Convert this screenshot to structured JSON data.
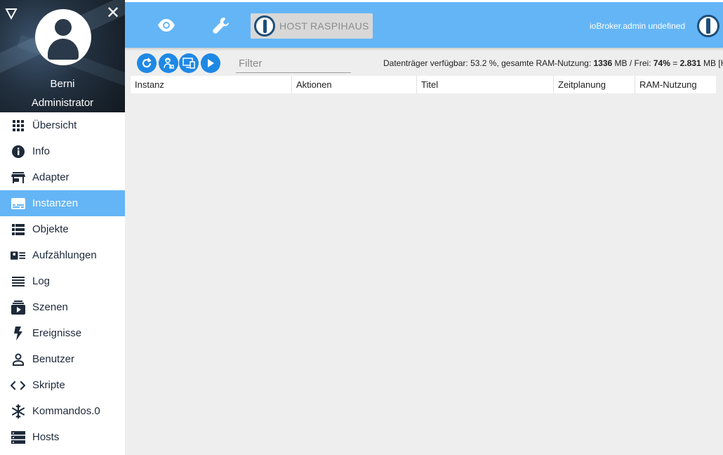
{
  "sidebar": {
    "user": {
      "name": "Berni",
      "role": "Administrator"
    },
    "items": [
      {
        "label": "Übersicht",
        "icon": "grid-icon",
        "active": false
      },
      {
        "label": "Info",
        "icon": "info-icon",
        "active": false
      },
      {
        "label": "Adapter",
        "icon": "store-icon",
        "active": false
      },
      {
        "label": "Instanzen",
        "icon": "instances-icon",
        "active": true
      },
      {
        "label": "Objekte",
        "icon": "list-icon",
        "active": false
      },
      {
        "label": "Aufzählungen",
        "icon": "enum-icon",
        "active": false
      },
      {
        "label": "Log",
        "icon": "log-icon",
        "active": false
      },
      {
        "label": "Szenen",
        "icon": "scenes-icon",
        "active": false
      },
      {
        "label": "Ereignisse",
        "icon": "lightning-icon",
        "active": false
      },
      {
        "label": "Benutzer",
        "icon": "user-icon",
        "active": false
      },
      {
        "label": "Skripte",
        "icon": "code-icon",
        "active": false
      },
      {
        "label": "Kommandos.0",
        "icon": "snowflake-icon",
        "active": false
      },
      {
        "label": "Hosts",
        "icon": "hosts-icon",
        "active": false
      }
    ]
  },
  "topbar": {
    "host_label": "HOST RASPIHAUS",
    "user_info": "ioBroker.admin undefined"
  },
  "toolbar": {
    "filter_placeholder": "Filter",
    "sysinfo_parts": {
      "disk_label": "Datenträger verfügbar: ",
      "disk_value": "53.2",
      "ram_label": " %, gesamte RAM-Nutzung: ",
      "ram_value": "1336",
      "free_label": " MB / Frei: ",
      "free_pct": "74%",
      "eq": " = ",
      "free_mb": "2.831",
      "tail": " MB [Ho"
    }
  },
  "table": {
    "columns": [
      "Instanz",
      "Aktionen",
      "Titel",
      "Zeitplanung",
      "RAM-Nutzung"
    ]
  },
  "colors": {
    "accent": "#64b5f6",
    "button": "#1e88e5",
    "sidebar_text": "#1e2a3a",
    "content_bg": "#eeeeee"
  }
}
